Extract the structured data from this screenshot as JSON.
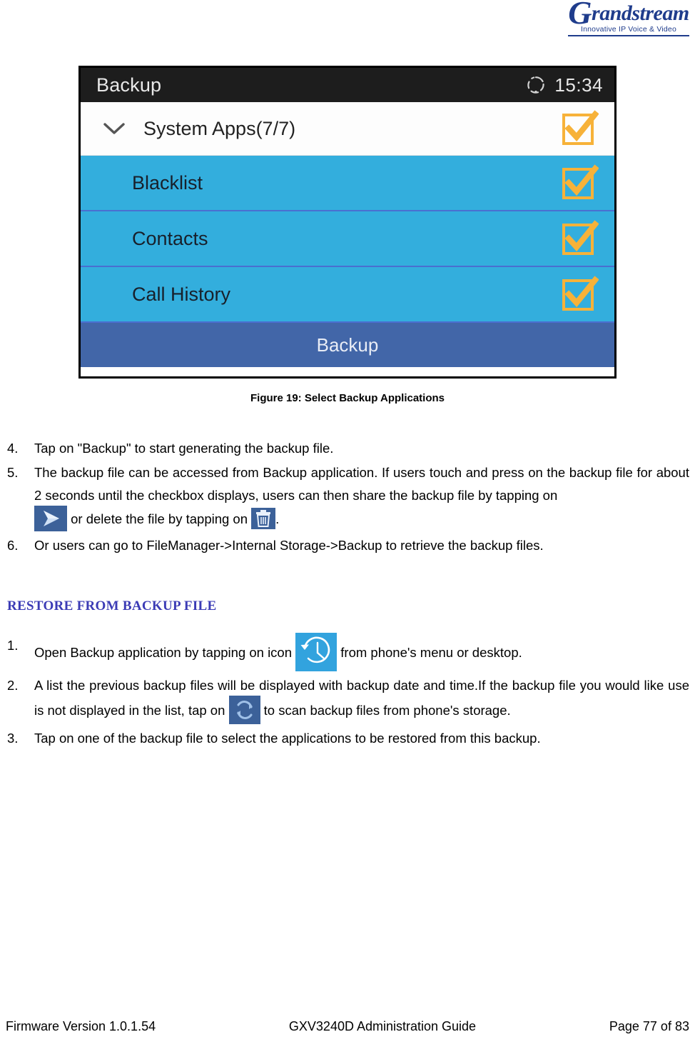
{
  "header": {
    "brand_name": "randstream",
    "brand_initial": "G",
    "brand_tagline": "Innovative IP Voice & Video",
    "brand_color": "#1F3C8C"
  },
  "phone_screenshot": {
    "statusbar": {
      "title": "Backup",
      "sync_icon": "sync-circle-icon",
      "time": "15:34"
    },
    "group_row": {
      "chevron_icon": "chevron-down-icon",
      "label": "System Apps(7/7)",
      "checkbox_icon": "checkbox-checked-icon",
      "checked": true
    },
    "app_rows": [
      {
        "label": "Blacklist",
        "checkbox_icon": "checkbox-checked-icon",
        "checked": true
      },
      {
        "label": "Contacts",
        "checkbox_icon": "checkbox-checked-icon",
        "checked": true
      },
      {
        "label": "Call History",
        "checkbox_icon": "checkbox-checked-icon",
        "checked": true
      }
    ],
    "action_button": {
      "label": "Backup"
    },
    "colors": {
      "statusbar_bg": "#1d1d1d",
      "row_bg": "#33aedd",
      "button_bg": "#4266a8",
      "checkbox": "#F7B239"
    }
  },
  "figure": {
    "caption": "Figure 19: Select Backup Applications"
  },
  "backup_steps": [
    {
      "num": "4.",
      "text": "Tap on \"Backup\" to start generating the backup file."
    },
    {
      "num": "5.",
      "text_part1": "The backup file can be accessed from Backup application. If users touch and press on the backup file for about 2 seconds until the checkbox displays, users can then share the backup file by tapping on",
      "share_icon": "share-arrow-icon",
      "text_part2": "or delete the file by tapping on",
      "trash_icon": "trash-can-icon",
      "text_part3": "."
    },
    {
      "num": "6.",
      "text": "Or users can go to FileManager->Internal Storage->Backup to retrieve the backup files."
    }
  ],
  "restore_section": {
    "heading": "RESTORE FROM BACKUP FILE",
    "heading_color": "#3B3BB5",
    "steps": [
      {
        "num": "1.",
        "text_part1": "Open Backup application by tapping on icon",
        "clock_icon": "history-clock-icon",
        "text_part2": "from phone's menu or desktop."
      },
      {
        "num": "2.",
        "text_part1": "A list the previous backup files will be displayed with backup date and time.If the backup file you would like use is not displayed in the list, tap on",
        "refresh_icon": "refresh-circle-icon",
        "text_part2": "to scan backup files from phone's storage."
      },
      {
        "num": "3.",
        "text": "Tap on one of the backup file to select the applications to be restored from this backup."
      }
    ]
  },
  "footer": {
    "left": "Firmware Version 1.0.1.54",
    "center": "GXV3240D Administration Guide",
    "right": "Page 77 of 83"
  }
}
